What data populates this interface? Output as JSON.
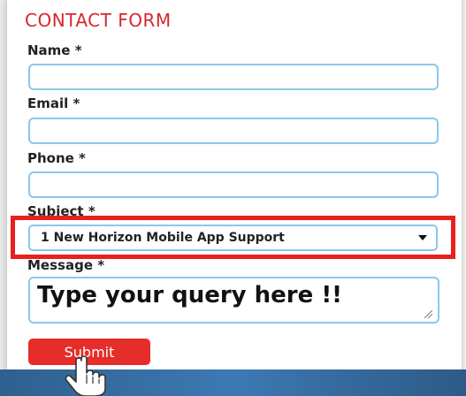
{
  "form": {
    "title": "CONTACT FORM",
    "name_label": "Name *",
    "email_label": "Email *",
    "phone_label": "Phone *",
    "subject_label": "Subject *",
    "subject_selected": "1 New Horizon Mobile App Support",
    "message_label": "Message *",
    "message_placeholder": "Type your query here !!",
    "submit_label": "Submit"
  },
  "colors": {
    "title": "#d8262c",
    "field_border": "#8dc7ea",
    "highlight": "#e8201c",
    "submit_bg": "#e52d2a"
  },
  "icons": {
    "select_arrow": "chevron-down-icon",
    "cursor": "hand-pointer-icon",
    "resize": "resize-grip-icon"
  }
}
